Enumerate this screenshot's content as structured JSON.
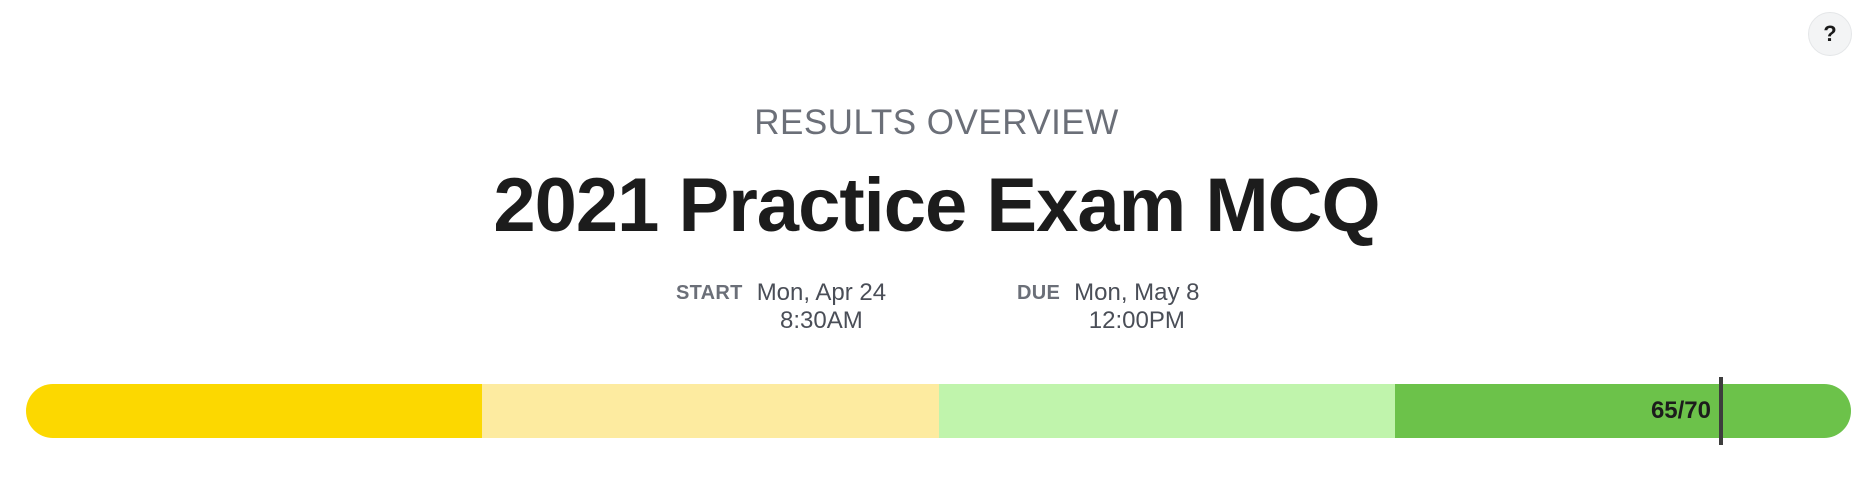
{
  "help": {
    "icon": "?",
    "icon_name": "question-mark-icon"
  },
  "header": {
    "overline": "RESULTS OVERVIEW",
    "title": "2021 Practice Exam MCQ"
  },
  "schedule": {
    "start": {
      "label": "START",
      "date": "Mon, Apr 24",
      "time": "8:30AM"
    },
    "due": {
      "label": "DUE",
      "date": "Mon, May 8",
      "time": "12:00PM"
    }
  },
  "progress": {
    "score_text": "65/70",
    "score": 65,
    "max": 70,
    "segment_colors": [
      "#fcd800",
      "#fdeba0",
      "#c0f4ac",
      "#6cc24a"
    ]
  }
}
